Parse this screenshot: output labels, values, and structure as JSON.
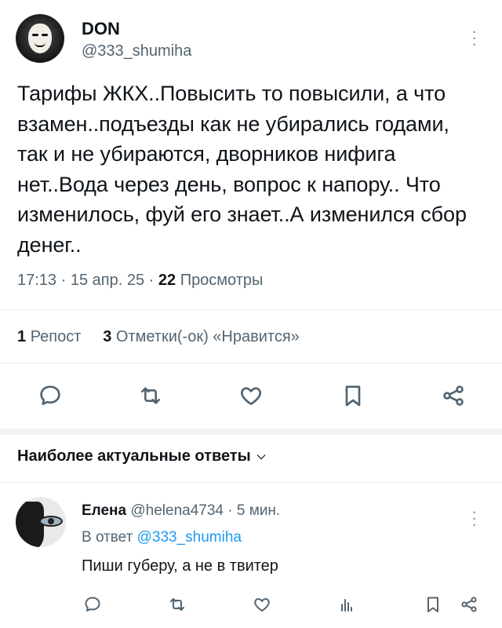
{
  "tweet": {
    "author_name": "DON",
    "author_handle": "@333_shumiha",
    "text": "Тарифы ЖКХ..Повысить то повысили, а что взамен..подъезды как не убирались годами, так и не убираются, дворников нифига нет..Вода через день, вопрос к напору.. Что изменилось, фуй его знает..А изменился сбор денег..",
    "time": "17:13",
    "date": "15 апр. 25",
    "views_count": "22",
    "views_label": "Просмотры",
    "reposts_count": "1",
    "reposts_label": "Репост",
    "likes_count": "3",
    "likes_label": "Отметки(-ок) «Нравится»"
  },
  "actions": {
    "reply_icon": "speech-bubble-icon",
    "retweet_icon": "retweet-icon",
    "like_icon": "heart-icon",
    "bookmark_icon": "bookmark-icon",
    "share_icon": "share-icon"
  },
  "replies_section": {
    "title": "Наиболее актуальные ответы"
  },
  "reply": {
    "author_name": "Елена",
    "author_handle": "@helena4734",
    "time_ago": "5 мин.",
    "reply_to_prefix": "В ответ",
    "reply_to_handle": "@333_shumiha",
    "text": "Пиши губеру, а не в твитер"
  },
  "colors": {
    "text_primary": "#0f1419",
    "text_secondary": "#536471",
    "link": "#1d9bf0",
    "divider": "#e6ecf0"
  }
}
